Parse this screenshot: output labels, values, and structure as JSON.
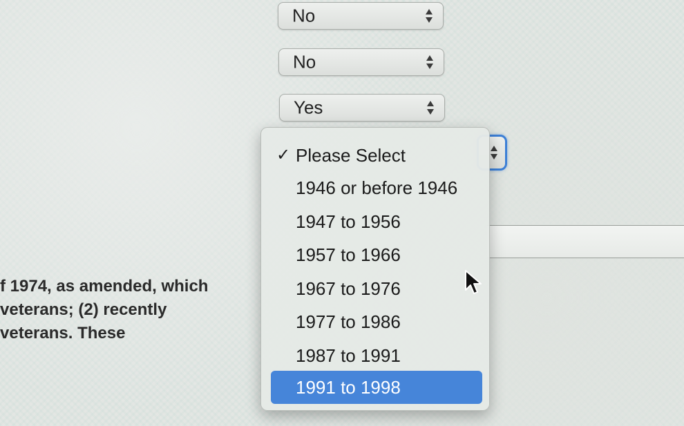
{
  "selects": [
    {
      "value": "No"
    },
    {
      "value": "No"
    },
    {
      "value": "Yes"
    }
  ],
  "dropdown": {
    "checked_item": "Please Select",
    "items": [
      "Please Select",
      "1946 or before 1946",
      "1947 to 1956",
      "1957 to 1966",
      "1967 to 1976",
      "1977 to 1986",
      "1987 to 1991",
      "1991 to 1998"
    ],
    "highlighted_item": "1991 to 1998",
    "checkmark": "✓"
  },
  "body_text": {
    "line1": "f 1974, as amended, which",
    "line2": " veterans; (2) recently",
    "line3": "veterans. These"
  },
  "colors": {
    "highlight": "#4685d9",
    "focus_ring": "#3c7fd6"
  },
  "icons": {
    "select_arrows": "up-down-chevrons-icon",
    "check": "check-icon",
    "cursor": "mouse-pointer-icon"
  }
}
